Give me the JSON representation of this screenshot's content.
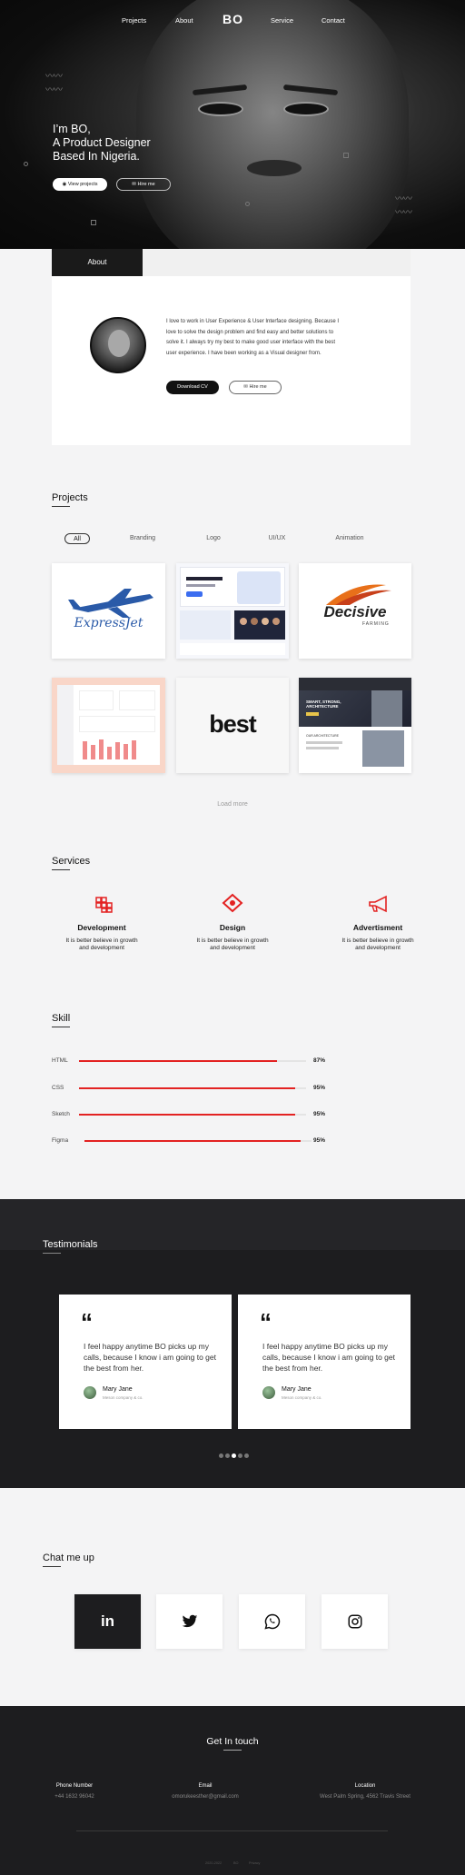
{
  "nav": {
    "items": [
      "Projects",
      "About",
      "Service",
      "Contact"
    ],
    "logo": "BO"
  },
  "hero": {
    "line1": "I’m BO,",
    "line2": "A Product Designer",
    "line3": "Based In Nigeria.",
    "view_projects": "View projects",
    "hire_me": "Hire me"
  },
  "about": {
    "tab": "About",
    "text": "I love to work in User Experience & User Interface designing. Because I love to solve the design problem and find easy and better solutions to solve it. I always try my best to make good user interface with the best user experience. I have been working as a Visual designer from.",
    "download_cv": "Download CV",
    "hire_me": "Hire me"
  },
  "projects": {
    "title": "Projects",
    "filters": [
      "All",
      "Branding",
      "Logo",
      "UI/UX",
      "Animation"
    ],
    "active_filter": "All",
    "load_more": "Load more",
    "items": [
      {
        "label": "ExpressJet"
      },
      {
        "label": ""
      },
      {
        "label": "Decisive",
        "sub": "FARMING"
      },
      {
        "label": ""
      },
      {
        "label": "best"
      },
      {
        "label": "SMART, STRONG, ARCHITECTURE",
        "sub": "OUR ARCHITECTURE"
      }
    ]
  },
  "services": {
    "title": "Services",
    "items": [
      {
        "title": "Development",
        "text": "It is better believe in growth and development",
        "icon": "grid-blocks-icon"
      },
      {
        "title": "Design",
        "text": "It is better believe in growth and development",
        "icon": "diamond-eye-icon"
      },
      {
        "title": "Advertisment",
        "text": "It is better believe in growth and development",
        "icon": "megaphone-icon"
      }
    ]
  },
  "skill": {
    "title": "Skill",
    "items": [
      {
        "name": "HTML",
        "pct": "87%",
        "level": 0.87
      },
      {
        "name": "CSS",
        "pct": "95%",
        "level": 0.95
      },
      {
        "name": "Sketch",
        "pct": "95%",
        "level": 0.95
      },
      {
        "name": "Figma",
        "pct": "95%",
        "level": 0.95
      }
    ]
  },
  "testimonials": {
    "title": "Testimonials",
    "cards": [
      {
        "quote": "I feel happy anytime BO picks up my calls,  because I know i am going to get the best from her.",
        "name": "Mary Jane",
        "company": "Meson company & co."
      },
      {
        "quote": "I feel happy anytime BO picks up my calls,  because I know i am going to get the best from her.",
        "name": "Mary Jane",
        "company": "Meson company & co."
      }
    ],
    "dots": 5,
    "active_dot": 2
  },
  "chat": {
    "title": "Chat me up",
    "icons": [
      "linkedin-icon",
      "twitter-icon",
      "whatsapp-icon",
      "instagram-icon"
    ]
  },
  "footer": {
    "title": "Get In touch",
    "phone_label": "Phone Number",
    "phone": "+44 1632 96042",
    "email_label": "Email",
    "email": "omorukeesther@gmail.com",
    "location_label": "Location",
    "location": "West Palm Spring, 4562 Travis Street",
    "bottom": [
      "2020-2022",
      "BO",
      "Privacy"
    ]
  },
  "colors": {
    "accent": "#e32222",
    "dark": "#1d1d1f"
  }
}
